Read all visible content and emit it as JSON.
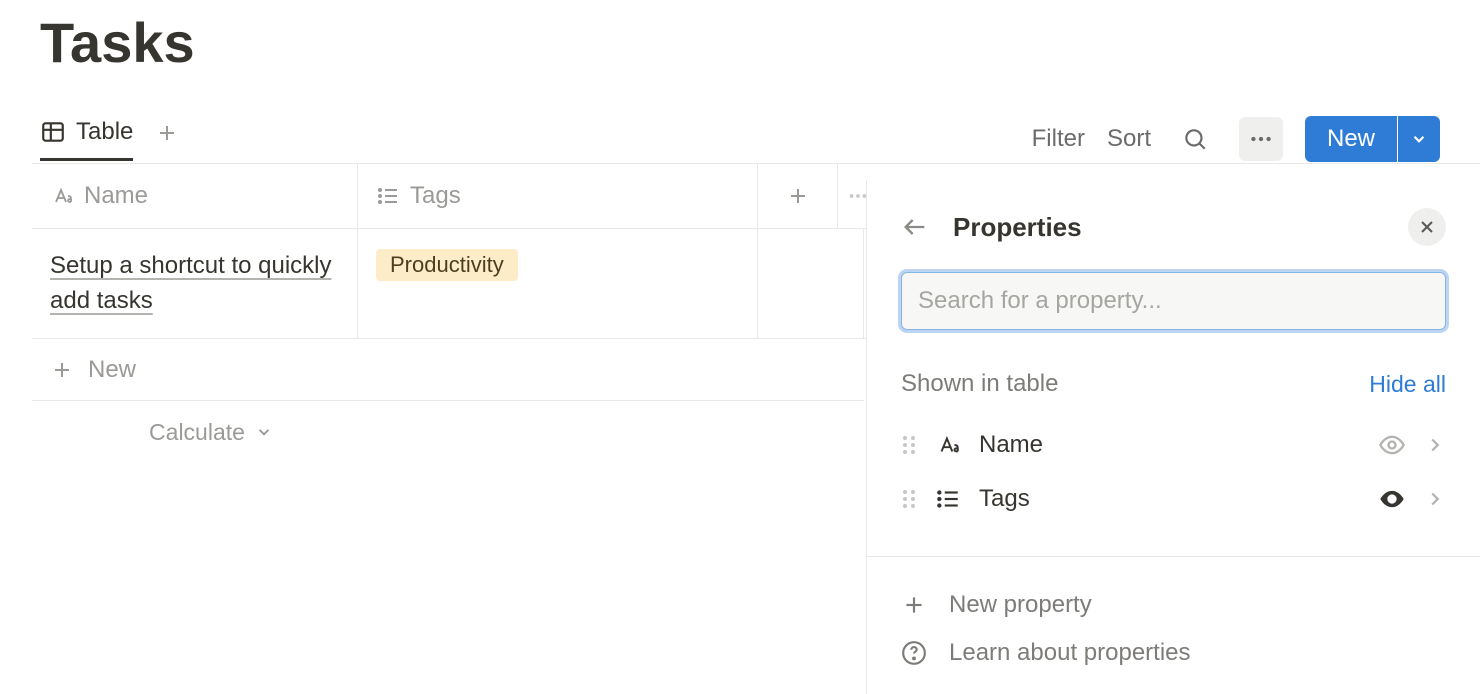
{
  "page": {
    "title": "Tasks"
  },
  "tabs": {
    "current": "Table"
  },
  "toolbar": {
    "filter": "Filter",
    "sort": "Sort",
    "new": "New"
  },
  "table": {
    "columns": {
      "name": "Name",
      "tags": "Tags"
    },
    "rows": [
      {
        "name": "Setup a shortcut to quickly add tasks",
        "tag": "Productivity"
      }
    ],
    "new_row": "New",
    "calculate": "Calculate"
  },
  "panel": {
    "title": "Properties",
    "search_placeholder": "Search for a property...",
    "section_label": "Shown in table",
    "hide_all": "Hide all",
    "items": [
      {
        "label": "Name"
      },
      {
        "label": "Tags"
      }
    ],
    "new_property": "New property",
    "learn": "Learn about properties"
  }
}
